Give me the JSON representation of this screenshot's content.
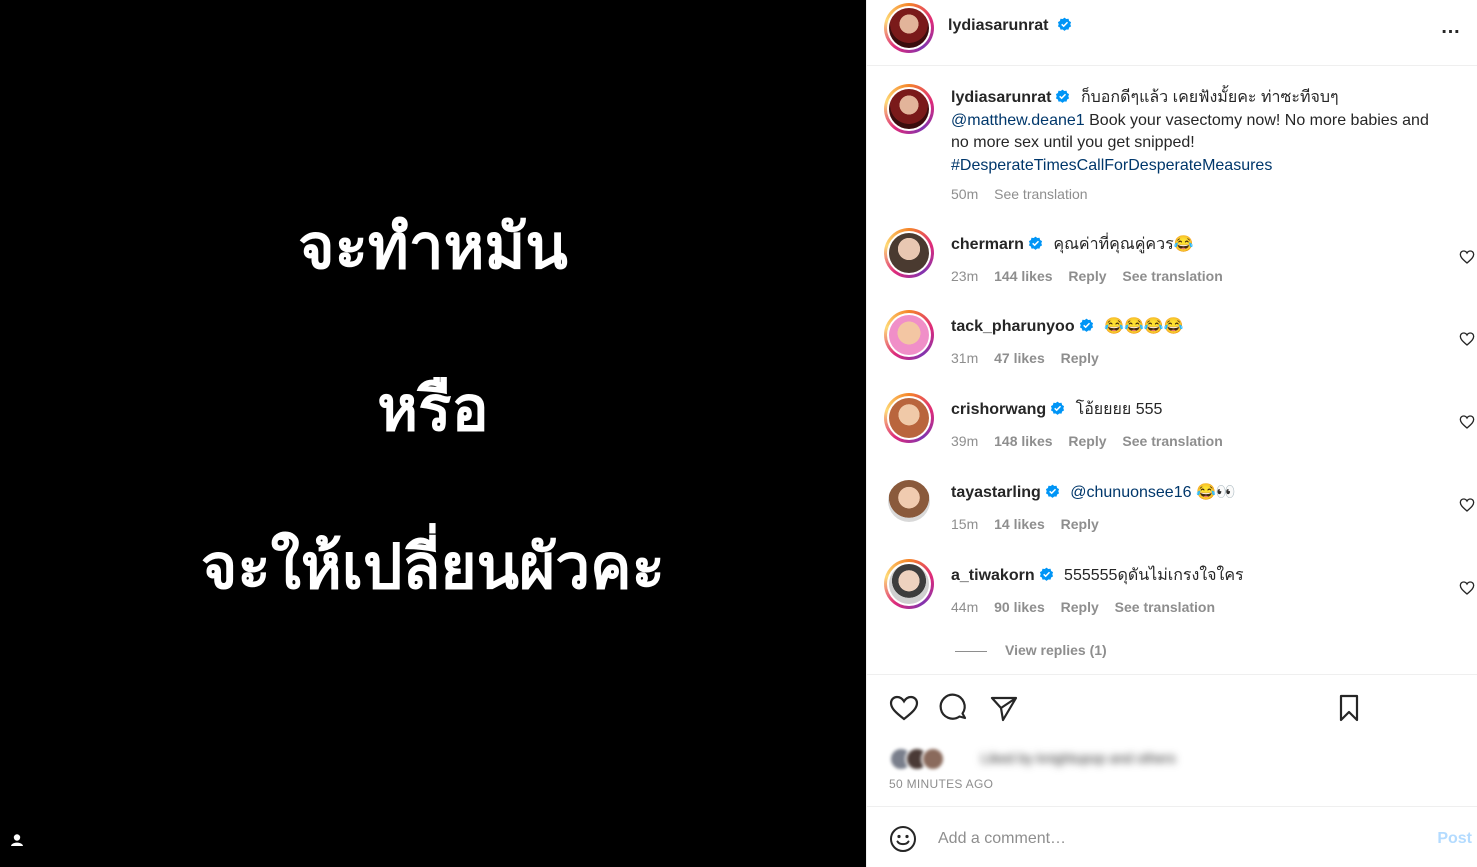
{
  "media": {
    "lines": [
      "จะทำหมัน",
      "หรือ",
      "จะให้เปลี่ยนผัวคะ"
    ]
  },
  "header": {
    "username": "lydiasarunrat",
    "more_icon": "…"
  },
  "caption": {
    "username": "lydiasarunrat",
    "text_thai": "ก็บอกดีๆแล้ว เคยฟังมั้ยคะ ท่าซะทีจบๆ",
    "mention": "@matthew.deane1",
    "text_en": " Book your vasectomy now! No more babies and no more sex until you get snipped!",
    "hashtag": "#DesperateTimesCallForDesperateMeasures",
    "time": "50m",
    "see_translation": "See translation"
  },
  "comments": [
    {
      "username": "chermarn",
      "text": "คุณค่าที่คุณคู่ควร😂",
      "time": "23m",
      "likes": "144 likes",
      "reply": "Reply",
      "translation": "See translation"
    },
    {
      "username": "tack_pharunyoo",
      "text": "😂😂😂😂",
      "time": "31m",
      "likes": "47 likes",
      "reply": "Reply",
      "translation": ""
    },
    {
      "username": "crishorwang",
      "text": "โอ้ยยยย 555",
      "time": "39m",
      "likes": "148 likes",
      "reply": "Reply",
      "translation": "See translation"
    },
    {
      "username": "tayastarling",
      "mention": "@chunuonsee16",
      "text": " 😂👀",
      "time": "15m",
      "likes": "14 likes",
      "reply": "Reply",
      "translation": ""
    },
    {
      "username": "a_tiwakorn",
      "text": "555555ดุดันไม่เกรงใจใคร",
      "time": "44m",
      "likes": "90 likes",
      "reply": "Reply",
      "translation": "See translation"
    }
  ],
  "view_replies": "View replies (1)",
  "likes_line": "Liked by knightupop and others",
  "timestamp": "50 MINUTES AGO",
  "add_comment": {
    "placeholder": "Add a comment…",
    "post_label": "Post"
  },
  "colors": {
    "verified": "#0095f6",
    "link": "#00376b",
    "muted": "#8e8e8e",
    "post_disabled": "#b3dbff"
  }
}
